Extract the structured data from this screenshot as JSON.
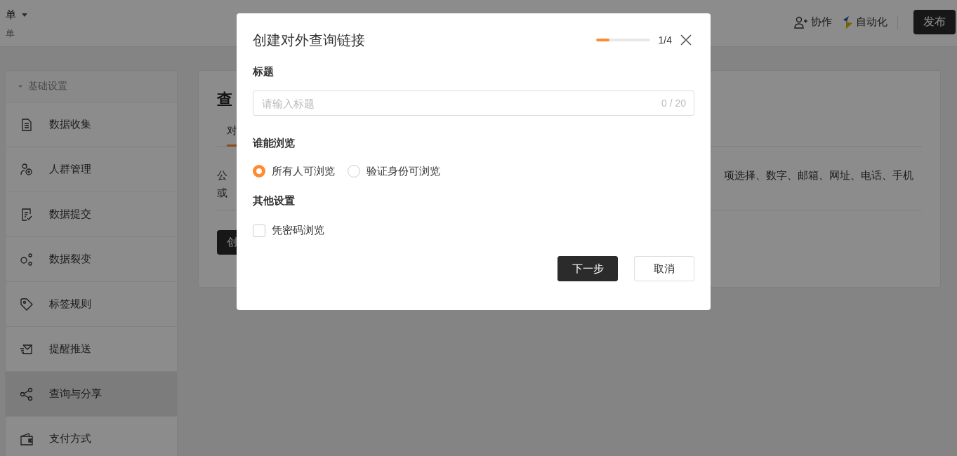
{
  "header": {
    "title": "单",
    "subtitle": "单",
    "actions": [
      {
        "label": "协作",
        "kind": "collaborate"
      },
      {
        "label": "自动化",
        "kind": "automation"
      }
    ],
    "publish_button": "发布"
  },
  "sidebar": {
    "section": {
      "label": "基础设置",
      "expanded": true
    },
    "items": [
      {
        "label": "数据收集",
        "kind": "document",
        "selected": false
      },
      {
        "label": "人群管理",
        "kind": "people",
        "selected": false
      },
      {
        "label": "数据提交",
        "kind": "submit",
        "selected": false
      },
      {
        "label": "数据裂变",
        "kind": "nodes",
        "selected": false
      },
      {
        "label": "标签规则",
        "kind": "tag",
        "selected": false
      },
      {
        "label": "提醒推送",
        "kind": "mail",
        "selected": false
      },
      {
        "label": "查询与分享",
        "kind": "share",
        "selected": true
      },
      {
        "label": "支付方式",
        "kind": "wallet",
        "selected": false
      }
    ]
  },
  "main": {
    "title": "查",
    "tabs": [
      {
        "label": "对",
        "selected": true
      }
    ],
    "description_left": [
      "公",
      "或"
    ],
    "description_right": "项选择、数字、邮箱、网址、电话、手机",
    "create_button": "创"
  },
  "dialog": {
    "title": "创建对外查询链接",
    "progress": {
      "level": 0.25,
      "reading": "1/4"
    },
    "title_field": {
      "label": "标题",
      "placeholder": "请输入标题",
      "counter": "0 / 20"
    },
    "visibility": {
      "label": "谁能浏览",
      "options": [
        {
          "label": "所有人可浏览",
          "selected": true
        },
        {
          "label": "验证身份可浏览",
          "selected": false
        }
      ]
    },
    "other": {
      "label": "其他设置",
      "options": [
        {
          "label": "凭密码浏览",
          "checked": false
        }
      ]
    },
    "buttons": [
      {
        "label": "下一步",
        "kind": "primary"
      },
      {
        "label": "取消",
        "kind": "default"
      }
    ]
  }
}
